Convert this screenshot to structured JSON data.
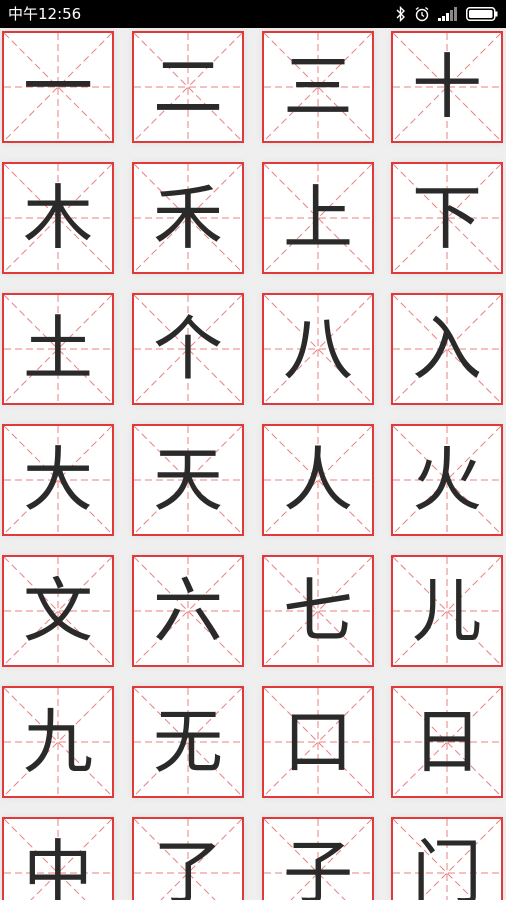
{
  "status_bar": {
    "time": "中午12:56",
    "icons": [
      "bluetooth-icon",
      "alarm-icon",
      "signal-icon",
      "battery-icon"
    ]
  },
  "colors": {
    "grid_border": "#e0393a",
    "guide_line": "#e88080",
    "character": "#2a2a2a",
    "background": "#efefef",
    "status_bar": "#000000"
  },
  "characters": [
    "一",
    "二",
    "三",
    "十",
    "木",
    "禾",
    "上",
    "下",
    "土",
    "个",
    "八",
    "入",
    "大",
    "天",
    "人",
    "火",
    "文",
    "六",
    "七",
    "儿",
    "九",
    "无",
    "口",
    "日",
    "中",
    "了",
    "子",
    "门"
  ]
}
